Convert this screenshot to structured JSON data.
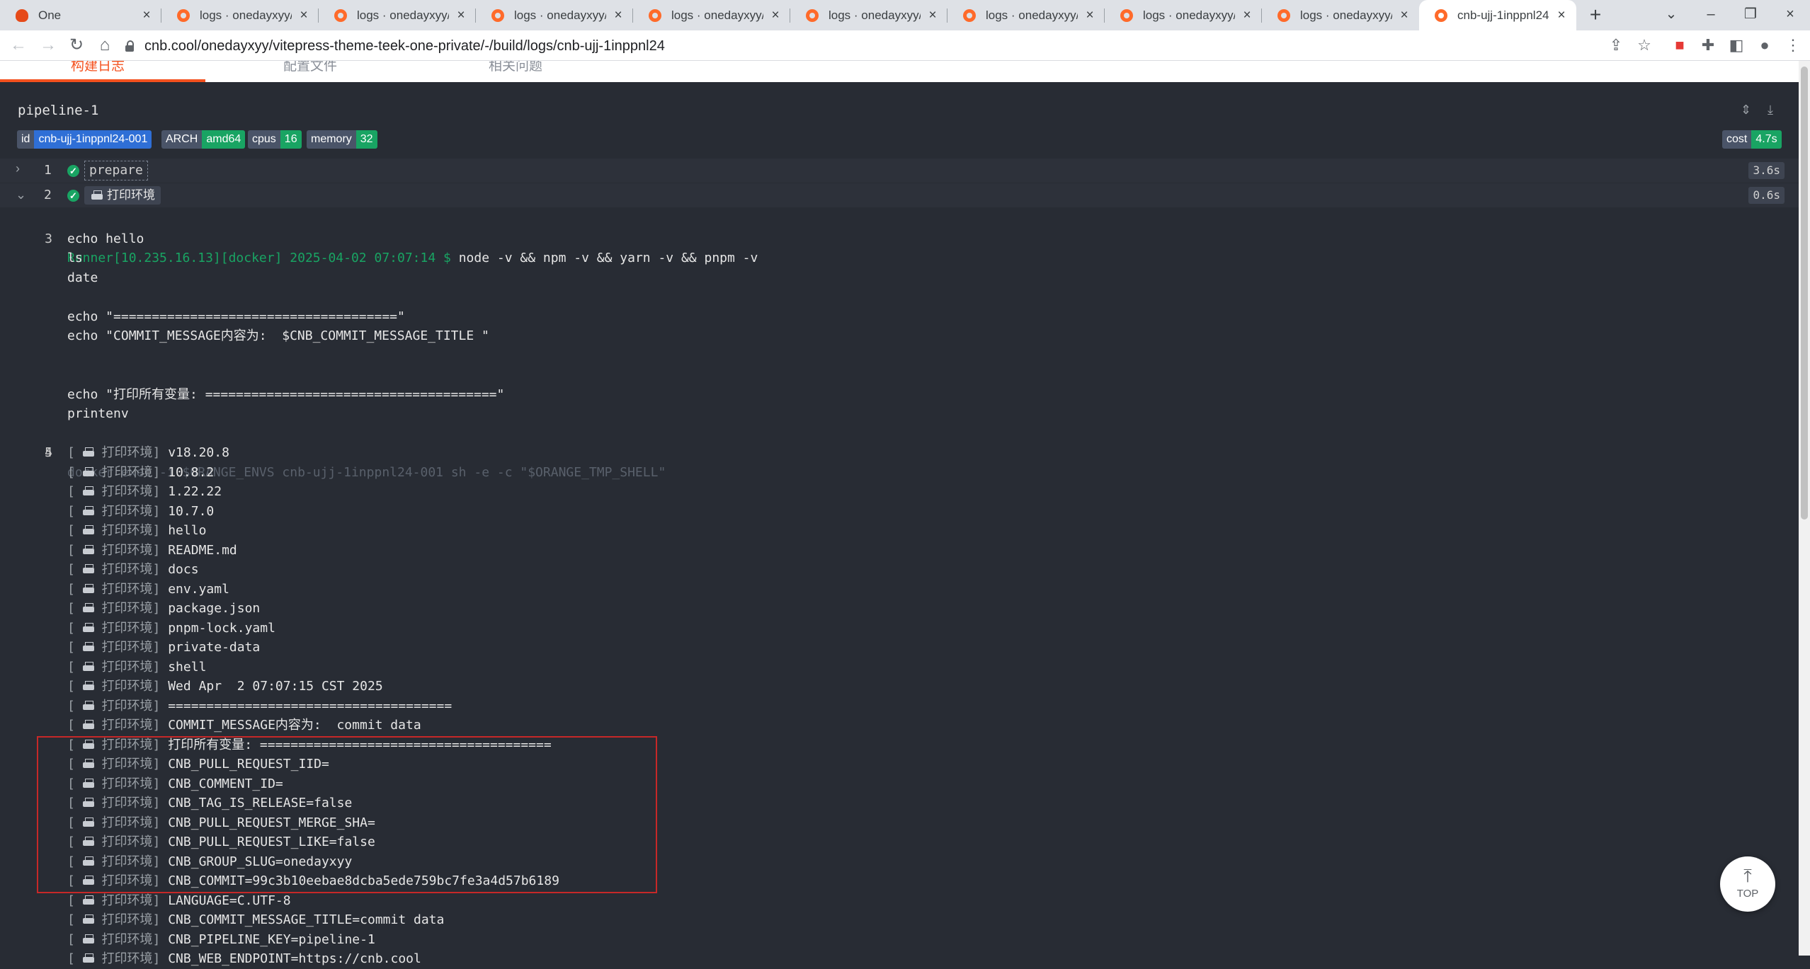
{
  "browser": {
    "tabs": [
      {
        "title": "One",
        "active": false
      },
      {
        "title": "logs · onedayxyy/vi",
        "active": false
      },
      {
        "title": "logs · onedayxyy/vi",
        "active": false
      },
      {
        "title": "logs · onedayxyy/vi",
        "active": false
      },
      {
        "title": "logs · onedayxyy/vi",
        "active": false
      },
      {
        "title": "logs · onedayxyy/vi",
        "active": false
      },
      {
        "title": "logs · onedayxyy/vi",
        "active": false
      },
      {
        "title": "logs · onedayxyy/vi",
        "active": false
      },
      {
        "title": "logs · onedayxyy/vi",
        "active": false
      },
      {
        "title": "cnb-ujj-1inppnl24 ·",
        "active": true
      }
    ],
    "url": "cnb.cool/onedayxyy/vitepress-theme-teek-one-private/-/build/logs/cnb-ujj-1inppnl24"
  },
  "page_tabs": [
    "构建日志",
    "配置文件",
    "相关问题"
  ],
  "pipeline": {
    "title": "pipeline-1",
    "tags": [
      {
        "key": "id",
        "value": "cnb-ujj-1inppnl24-001",
        "color": "#2f6fd6"
      },
      {
        "key": "ARCH",
        "value": "amd64",
        "color": "#19a463"
      },
      {
        "key": "cpus",
        "value": "16",
        "color": "#19a463"
      },
      {
        "key": "memory",
        "value": "32",
        "color": "#19a463"
      }
    ],
    "cost": {
      "key": "cost",
      "value": "4.7s",
      "color": "#19a463"
    }
  },
  "stages": [
    {
      "num": "1",
      "name": "prepare",
      "duration": "3.6s",
      "expanded": false
    },
    {
      "num": "2",
      "name": "打印环境",
      "duration": "0.6s",
      "expanded": true
    }
  ],
  "log": {
    "runner_prefix": "Runner[10.235.16.13][docker] 2025-04-02 07:07:14 $",
    "command_lines": [
      "node -v && npm -v && yarn -v && pnpm -v",
      "echo hello",
      "ls",
      "date",
      "",
      "echo \"=====================================\"",
      "echo \"COMMIT_MESSAGE内容为:  $CNB_COMMIT_MESSAGE_TITLE \"",
      "",
      "",
      "echo \"打印所有变量: ======================================\"",
      "printenv"
    ],
    "docker_line": "docker exec -i $ORANGE_ENVS cnb-ujj-1inppnl24-001 sh -e -c \"$ORANGE_TMP_SHELL\"",
    "output_prefix": "打印环境",
    "output_lines": [
      "v18.20.8",
      "10.8.2",
      "1.22.22",
      "10.7.0",
      "hello",
      "README.md",
      "docs",
      "env.yaml",
      "package.json",
      "pnpm-lock.yaml",
      "private-data",
      "shell",
      "Wed Apr  2 07:07:15 CST 2025",
      "=====================================",
      "COMMIT_MESSAGE内容为:  commit data",
      "打印所有变量: ======================================",
      "CNB_PULL_REQUEST_IID=",
      "CNB_COMMENT_ID=",
      "CNB_TAG_IS_RELEASE=false",
      "CNB_PULL_REQUEST_MERGE_SHA=",
      "CNB_PULL_REQUEST_LIKE=false",
      "CNB_GROUP_SLUG=onedayxyy",
      "CNB_COMMIT=99c3b10eebae8dcba5ede759bc7fe3a4d57b6189",
      "LANGUAGE=C.UTF-8",
      "CNB_COMMIT_MESSAGE_TITLE=commit data",
      "CNB_PIPELINE_KEY=pipeline-1",
      "CNB_WEB_ENDPOINT=https://cnb.cool"
    ]
  },
  "back_to_top": {
    "label": "TOP"
  }
}
